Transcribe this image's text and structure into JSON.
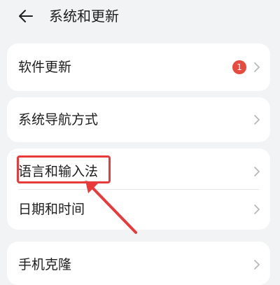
{
  "header": {
    "title": "系统和更新"
  },
  "settings": {
    "items": [
      {
        "label": "软件更新",
        "badge": "1"
      },
      {
        "label": "系统导航方式"
      },
      {
        "label": "语言和输入法"
      },
      {
        "label": "日期和时间"
      },
      {
        "label": "手机克隆"
      }
    ]
  },
  "colors": {
    "background": "#f1f3f5",
    "card": "#ffffff",
    "badge": "#e84a3f",
    "annotation": "#e83a3a"
  }
}
